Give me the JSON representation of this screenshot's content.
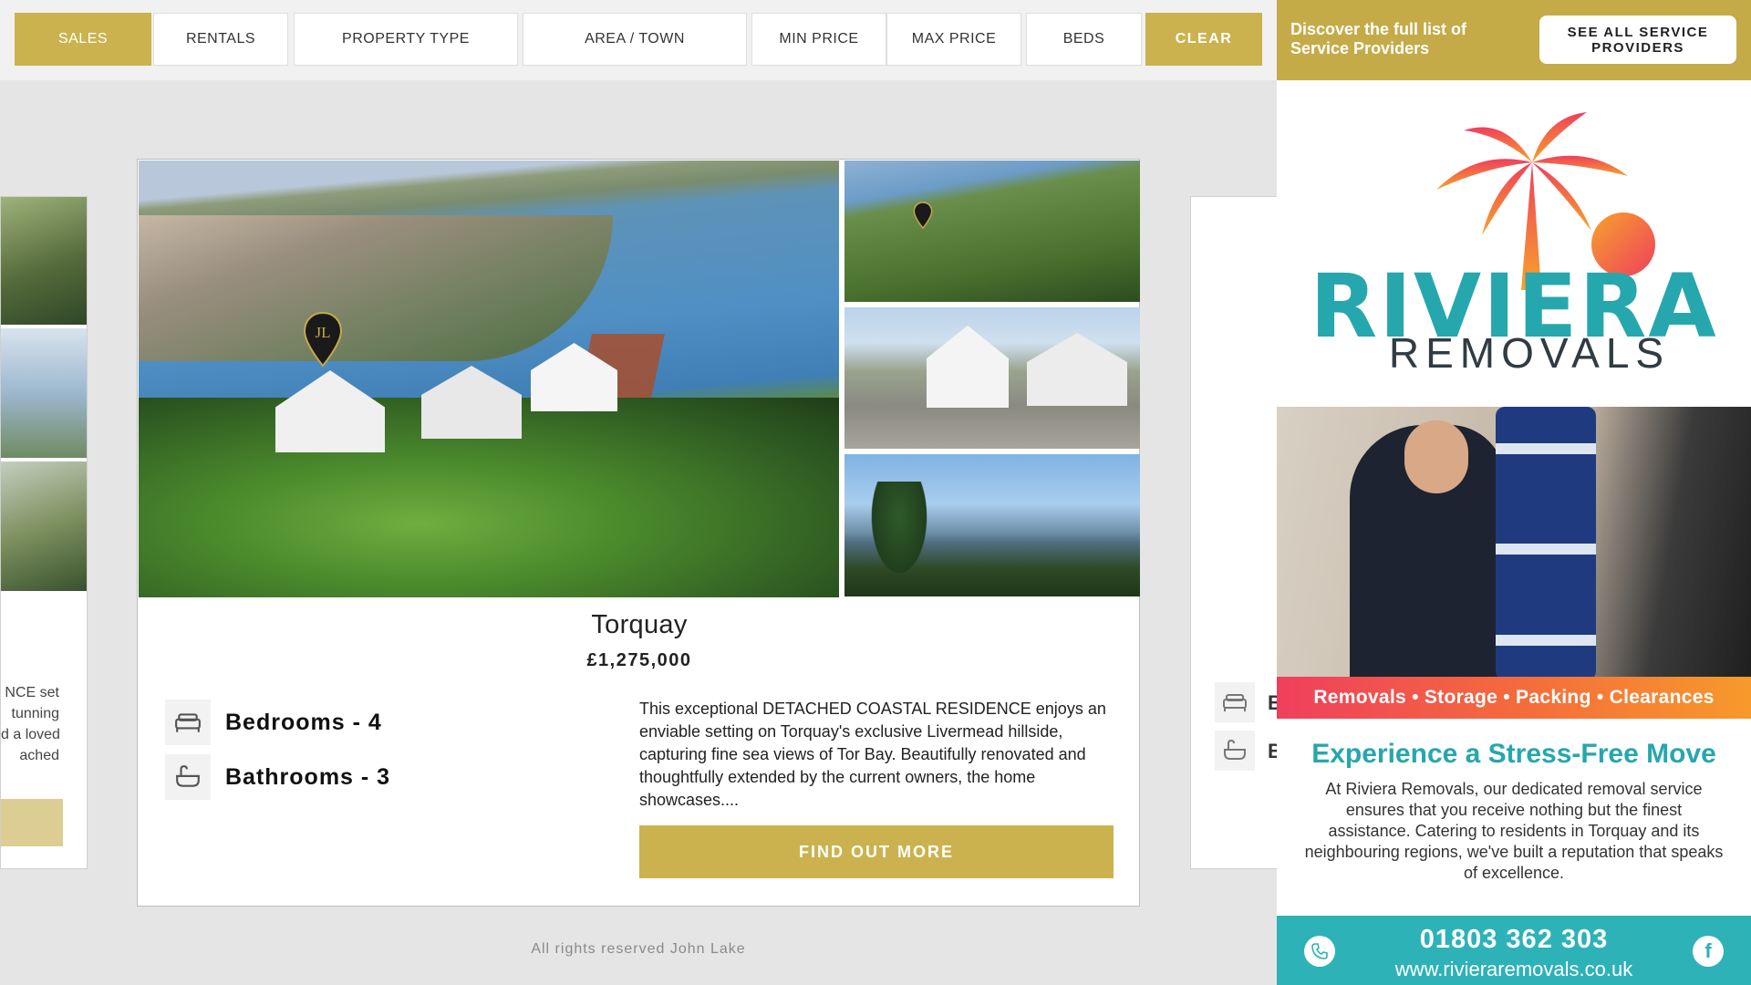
{
  "filters": {
    "sales": "SALES",
    "rentals": "RENTALS",
    "property_type": "PROPERTY TYPE",
    "area_town": "AREA / TOWN",
    "min_price": "MIN PRICE",
    "max_price": "MAX PRICE",
    "beds": "BEDS",
    "clear": "CLEAR"
  },
  "left_card": {
    "text_fragments": [
      "NCE set",
      "tunning",
      "d a loved",
      "ached"
    ]
  },
  "right_card": {
    "labels": [
      "B",
      "B"
    ]
  },
  "listing": {
    "town": "Torquay",
    "price": "£1,275,000",
    "bedrooms": "Bedrooms - 4",
    "bathrooms": "Bathrooms - 3",
    "description": "This exceptional DETACHED COASTAL RESIDENCE enjoys an enviable setting on Torquay's exclusive Livermead hillside, capturing fine sea views of Tor Bay. Beautifully renovated and thoughtfully extended by the current owners, the home showcases....",
    "cta": "FIND OUT MORE",
    "pin_monogram": "JL"
  },
  "footer": {
    "text": "All rights reserved John Lake"
  },
  "ad_header": {
    "text": "Discover the full list of Service Providers",
    "button": "SEE ALL SERVICE PROVIDERS"
  },
  "ad": {
    "brand_main": "RIVIERA",
    "brand_sub": "REMOVALS",
    "services": "Removals • Storage • Packing • Clearances",
    "headline": "Experience a Stress-Free Move",
    "body": "At Riviera Removals, our dedicated removal service ensures that you receive nothing but the finest assistance. Catering to residents in Torquay and its neighbouring regions, we've built a reputation that speaks of excellence.",
    "phone": "01803 362 303",
    "website": "www.rivieraremovals.co.uk",
    "colors": {
      "teal": "#26a7ad",
      "gold": "#c5aa48",
      "coral": "#ef3f5d"
    }
  },
  "colors": {
    "accent_gold": "#cbb24e"
  }
}
